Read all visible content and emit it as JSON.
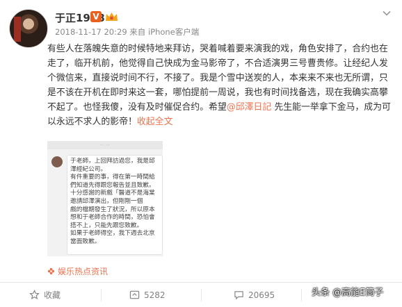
{
  "author": {
    "name": "于正1978",
    "vip_badge": "V"
  },
  "meta": {
    "time": "2018-11-17 20:29",
    "source_prefix": "来自",
    "client": "iPhone客户端"
  },
  "post": {
    "part1": "有些人在落魄失意的时候特地来拜访，哭着喊着要来演我的戏，角色安排了，合约也在走了，临开机前，他觉得自己快成为金马影帝了，不合适演男三号曹贵修。让经纪人发个微信来，直接说时间不行，不接了。我是个雪中送炭的人，本来来不来也无所谓，只是不该在开机在即时来这一套，哪怕提前一周说，我也有时间找备选，现在我确实高攀不起了。也怪我傻，没有及时催促合约。希望",
    "mention": "@邱澤日記",
    "part2": " 先生能一举拿下金马，成为可以永远不求人的影帝！",
    "expand": "收起全文"
  },
  "image": {
    "lines": [
      "于老師，上回拜訪過您，我是邱",
      "澤經紀公司。",
      "有件重要的事，得在第一時間給",
      "們知道先得跟您報告並且致歉。",
      "十分感謝的新戲「醫道不是海棠",
      "邀請邱澤演出，但剛剛一個",
      "戲的檔期發生了狀況，所以原本",
      "想和于老師合作的時間，恐怕會",
      "搭不上，只能先跟您致歉。",
      "如果于老師得空，我下週去北京",
      "當面致歉。"
    ]
  },
  "source": {
    "label": "娱乐热点资讯"
  },
  "actions": {
    "favorite": "收藏",
    "repost": "5282",
    "comment": "20695"
  },
  "watermark": "头条 @高能E筒子",
  "colors": {
    "accent": "#eb7350",
    "vip": "#e9601f"
  }
}
